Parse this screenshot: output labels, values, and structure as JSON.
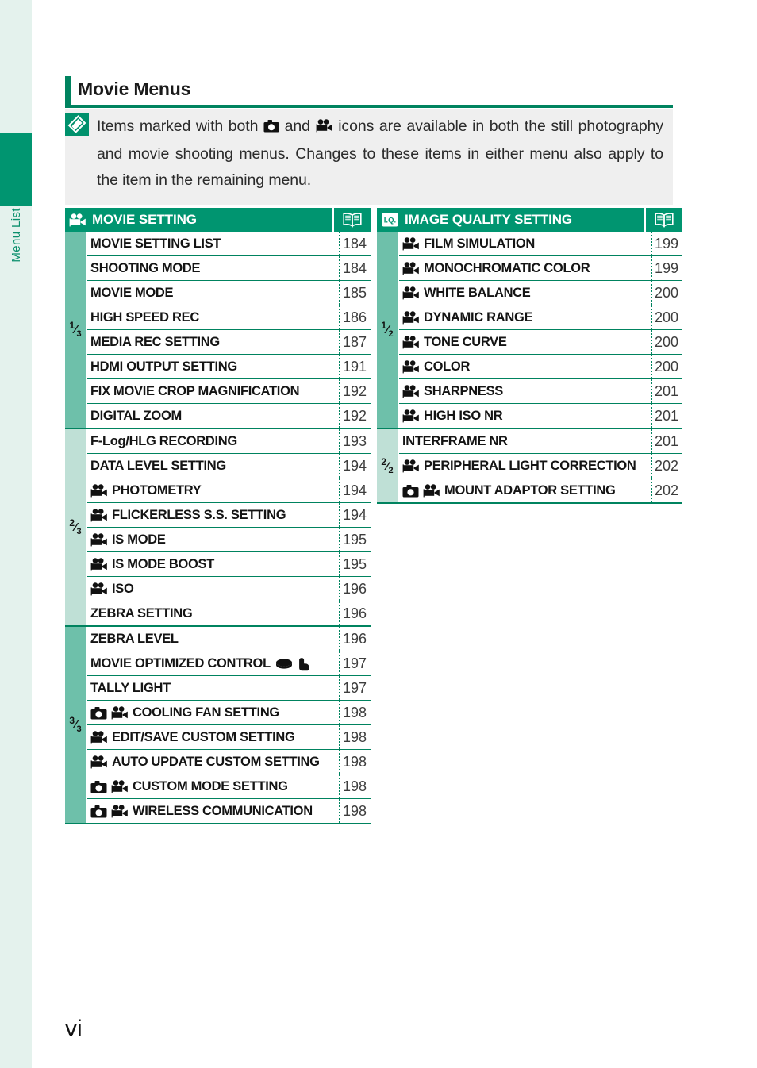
{
  "sidebar": {
    "tab_label": "Menu List",
    "tab_color": "#009570",
    "strip_color": "#e4f2ed"
  },
  "page": {
    "title": "Movie Menus",
    "number": "vi",
    "accent_color": "#009570",
    "rule_color": "#00835f"
  },
  "note": {
    "icon": "note-tag-icon",
    "text_part1": "Items marked with both ",
    "icon1": "still-camera-icon",
    "text_part2": " and ",
    "icon2": "movie-camera-icon",
    "text_part3": " icons are available in both the still photography and movie shooting menus. Changes to these items in either menu also apply to the item in the remaining menu.",
    "background": "#efefef"
  },
  "tables": [
    {
      "id": "movie-setting",
      "header_icon": "movie-camera-icon",
      "header_title": "MOVIE SETTING",
      "page_col_icon": "open-book-icon",
      "groups": [
        {
          "label_num": "1",
          "label_den": "3",
          "shade": "dark",
          "rows": [
            {
              "icons": [],
              "label": "MOVIE SETTING LIST",
              "trailing_icons": [],
              "page": "184"
            },
            {
              "icons": [],
              "label": "SHOOTING MODE",
              "trailing_icons": [],
              "page": "184"
            },
            {
              "icons": [],
              "label": "MOVIE MODE",
              "trailing_icons": [],
              "page": "185"
            },
            {
              "icons": [],
              "label": "HIGH SPEED REC",
              "trailing_icons": [],
              "page": "186"
            },
            {
              "icons": [],
              "label": "MEDIA REC SETTING",
              "trailing_icons": [],
              "page": "187"
            },
            {
              "icons": [],
              "label": "HDMI OUTPUT SETTING",
              "trailing_icons": [],
              "page": "191"
            },
            {
              "icons": [],
              "label": "FIX MOVIE CROP MAGNIFICATION",
              "trailing_icons": [],
              "page": "192"
            },
            {
              "icons": [],
              "label": "DIGITAL ZOOM",
              "trailing_icons": [],
              "page": "192"
            }
          ]
        },
        {
          "label_num": "2",
          "label_den": "3",
          "shade": "light",
          "rows": [
            {
              "icons": [],
              "label": "F-Log/HLG RECORDING",
              "trailing_icons": [],
              "page": "193"
            },
            {
              "icons": [],
              "label": "DATA LEVEL SETTING",
              "trailing_icons": [],
              "page": "194"
            },
            {
              "icons": [
                "movie-camera-icon"
              ],
              "label": "PHOTOMETRY",
              "trailing_icons": [],
              "page": "194"
            },
            {
              "icons": [
                "movie-camera-icon"
              ],
              "label": "FLICKERLESS S.S. SETTING",
              "trailing_icons": [],
              "page": "194"
            },
            {
              "icons": [
                "movie-camera-icon"
              ],
              "label": "IS MODE",
              "trailing_icons": [],
              "page": "195"
            },
            {
              "icons": [
                "movie-camera-icon"
              ],
              "label": "IS MODE BOOST",
              "trailing_icons": [],
              "page": "195"
            },
            {
              "icons": [
                "movie-camera-icon"
              ],
              "label": "ISO",
              "trailing_icons": [],
              "page": "196"
            },
            {
              "icons": [],
              "label": "ZEBRA SETTING",
              "trailing_icons": [],
              "page": "196"
            }
          ]
        },
        {
          "label_num": "3",
          "label_den": "3",
          "shade": "dark",
          "rows": [
            {
              "icons": [],
              "label": "ZEBRA LEVEL",
              "trailing_icons": [],
              "page": "196"
            },
            {
              "icons": [],
              "label": "MOVIE OPTIMIZED CONTROL",
              "trailing_icons": [
                "dial-icon",
                "hand-press-icon"
              ],
              "page": "197"
            },
            {
              "icons": [],
              "label": "TALLY LIGHT",
              "trailing_icons": [],
              "page": "197"
            },
            {
              "icons": [
                "still-camera-icon",
                "movie-camera-icon"
              ],
              "label": "COOLING FAN SETTING",
              "trailing_icons": [],
              "page": "198"
            },
            {
              "icons": [
                "movie-camera-icon"
              ],
              "label": "EDIT/SAVE CUSTOM SETTING",
              "trailing_icons": [],
              "page": "198"
            },
            {
              "icons": [
                "movie-camera-icon"
              ],
              "label": "AUTO UPDATE CUSTOM SETTING",
              "trailing_icons": [],
              "page": "198",
              "wrap": true
            },
            {
              "icons": [
                "still-camera-icon",
                "movie-camera-icon"
              ],
              "label": "CUSTOM MODE SETTING",
              "trailing_icons": [],
              "page": "198"
            },
            {
              "icons": [
                "still-camera-icon",
                "movie-camera-icon"
              ],
              "label": "WIRELESS COMMUNICATION",
              "trailing_icons": [],
              "page": "198"
            }
          ]
        }
      ]
    },
    {
      "id": "image-quality-setting",
      "header_icon": "iq-badge-icon",
      "header_title": "IMAGE QUALITY SETTING",
      "page_col_icon": "open-book-icon",
      "groups": [
        {
          "label_num": "1",
          "label_den": "2",
          "shade": "dark",
          "rows": [
            {
              "icons": [
                "movie-camera-icon"
              ],
              "label": "FILM SIMULATION",
              "trailing_icons": [],
              "page": "199"
            },
            {
              "icons": [
                "movie-camera-icon"
              ],
              "label": "MONOCHROMATIC COLOR",
              "trailing_icons": [],
              "page": "199"
            },
            {
              "icons": [
                "movie-camera-icon"
              ],
              "label": "WHITE BALANCE",
              "trailing_icons": [],
              "page": "200"
            },
            {
              "icons": [
                "movie-camera-icon"
              ],
              "label": "DYNAMIC RANGE",
              "trailing_icons": [],
              "page": "200"
            },
            {
              "icons": [
                "movie-camera-icon"
              ],
              "label": "TONE CURVE",
              "trailing_icons": [],
              "page": "200"
            },
            {
              "icons": [
                "movie-camera-icon"
              ],
              "label": "COLOR",
              "trailing_icons": [],
              "page": "200"
            },
            {
              "icons": [
                "movie-camera-icon"
              ],
              "label": "SHARPNESS",
              "trailing_icons": [],
              "page": "201"
            },
            {
              "icons": [
                "movie-camera-icon"
              ],
              "label": "HIGH ISO NR",
              "trailing_icons": [],
              "page": "201"
            }
          ]
        },
        {
          "label_num": "2",
          "label_den": "2",
          "shade": "light",
          "rows": [
            {
              "icons": [],
              "label": "INTERFRAME NR",
              "trailing_icons": [],
              "page": "201"
            },
            {
              "icons": [
                "movie-camera-icon"
              ],
              "label": "PERIPHERAL LIGHT CORRECTION",
              "trailing_icons": [],
              "page": "202"
            },
            {
              "icons": [
                "still-camera-icon",
                "movie-camera-icon"
              ],
              "label": "MOUNT ADAPTOR SETTING",
              "trailing_icons": [],
              "page": "202"
            }
          ]
        }
      ]
    }
  ]
}
